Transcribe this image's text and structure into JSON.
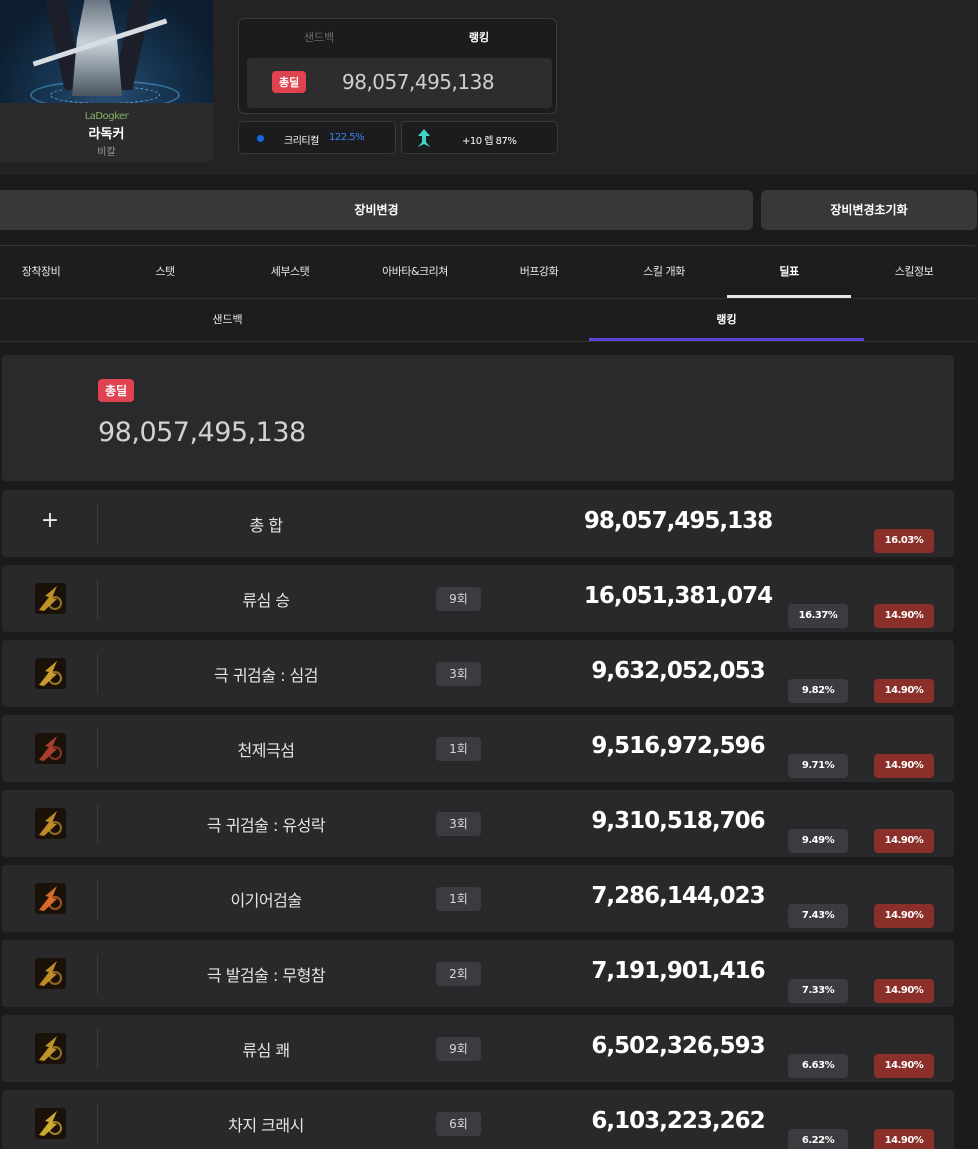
{
  "character": {
    "server": "LaDogker",
    "name": "라독커",
    "job": "비칼"
  },
  "mini_panel": {
    "tabs": [
      "샌드백",
      "랭킹"
    ],
    "active_tab": "랭킹",
    "total_badge": "총딜",
    "total_value": "98,057,495,138"
  },
  "crit": {
    "label": "크리티컬",
    "value": "122.5%"
  },
  "enhance": {
    "text": "+10 렙 87%",
    "icon": "arrow-up-icon"
  },
  "actions": {
    "change": "장비변경",
    "reset": "장비변경초기화"
  },
  "main_tabs": [
    "장착장비",
    "스탯",
    "세부스탯",
    "아바타&크리쳐",
    "버프강화",
    "스킬 개화",
    "딜표",
    "스킬정보"
  ],
  "main_tab_active": "딜표",
  "sub_tabs": [
    "샌드백",
    "랭킹"
  ],
  "sub_tab_active": "랭킹",
  "total_card": {
    "badge": "총딜",
    "value": "98,057,495,138"
  },
  "summary_row": {
    "icon": "plus-icon",
    "name": "총 합",
    "damage": "98,057,495,138",
    "pct_red": "16.03%"
  },
  "skills": [
    {
      "name": "류심 승",
      "hits": "9회",
      "damage": "16,051,381,074",
      "pct_gray": "16.37%",
      "pct_red": "14.90%",
      "icon": "ryusim-seung-icon",
      "color": "#c89a2a"
    },
    {
      "name": "극 귀검술 : 심검",
      "hits": "3회",
      "damage": "9,632,052,053",
      "pct_gray": "9.82%",
      "pct_red": "14.90%",
      "icon": "simgeom-icon",
      "color": "#d6a231"
    },
    {
      "name": "천제극섬",
      "hits": "1회",
      "damage": "9,516,972,596",
      "pct_gray": "9.71%",
      "pct_red": "14.90%",
      "icon": "cheonje-icon",
      "color": "#b2412f"
    },
    {
      "name": "극 귀검술 : 유성락",
      "hits": "3회",
      "damage": "9,310,518,706",
      "pct_gray": "9.49%",
      "pct_red": "14.90%",
      "icon": "yuseongrak-icon",
      "color": "#c7902a"
    },
    {
      "name": "이기어검술",
      "hits": "1회",
      "damage": "7,286,144,023",
      "pct_gray": "7.43%",
      "pct_red": "14.90%",
      "icon": "igieo-icon",
      "color": "#e0702a"
    },
    {
      "name": "극 발검술 : 무형참",
      "hits": "2회",
      "damage": "7,191,901,416",
      "pct_gray": "7.33%",
      "pct_red": "14.90%",
      "icon": "muhyeongcham-icon",
      "color": "#c7902a"
    },
    {
      "name": "류심 쾌",
      "hits": "9회",
      "damage": "6,502,326,593",
      "pct_gray": "6.63%",
      "pct_red": "14.90%",
      "icon": "ryusim-kwae-icon",
      "color": "#c89a2a"
    },
    {
      "name": "차지 크래시",
      "hits": "6회",
      "damage": "6,103,223,262",
      "pct_gray": "6.22%",
      "pct_red": "14.90%",
      "icon": "charge-crash-icon",
      "color": "#d8b235"
    }
  ],
  "colors": {
    "accent_purple": "#5a46d6",
    "badge_red": "#e0424f",
    "pct_red": "#8a2f2a",
    "crit_blue": "#3b82f6"
  }
}
